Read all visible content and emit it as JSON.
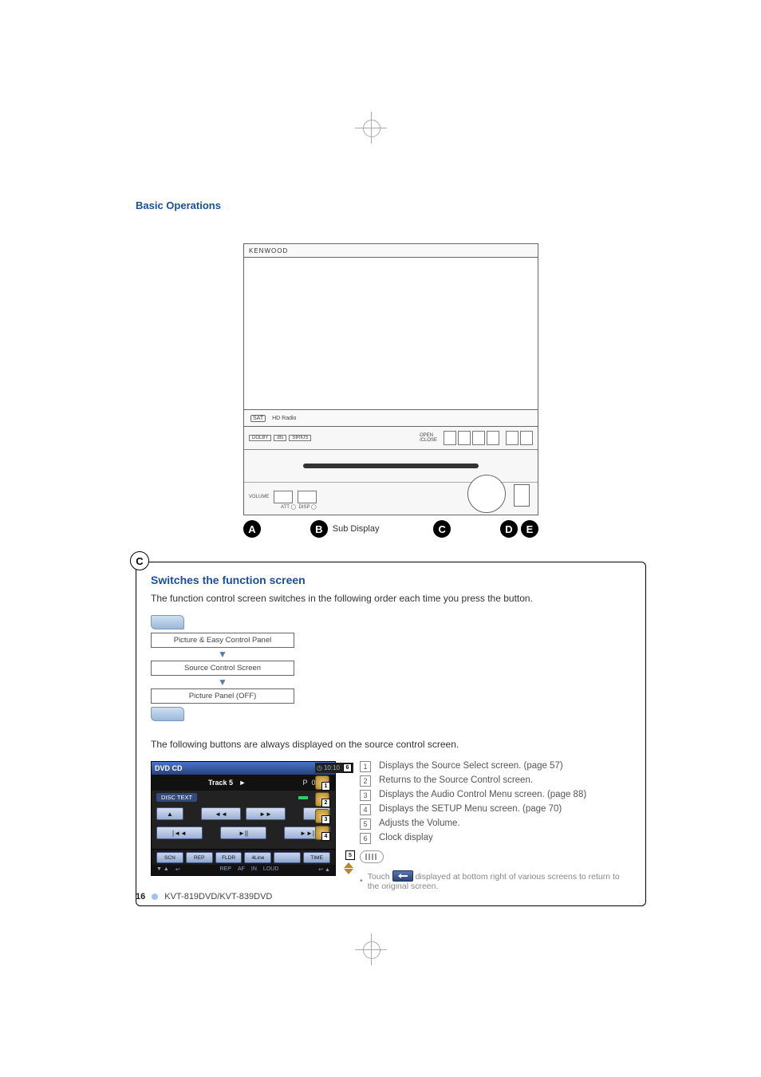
{
  "header": {
    "section_title": "Basic Operations"
  },
  "device": {
    "brand": "KENWOOD",
    "strip_badge_1": "SAT",
    "strip_badge_2": "HD Radio"
  },
  "callouts": {
    "a": "A",
    "b": "B",
    "c": "C",
    "d": "D",
    "e": "E",
    "sub_display": "Sub Display"
  },
  "box": {
    "badge": "C",
    "heading": "Switches the function screen",
    "intro": "The function control screen switches in the following order each time you press the button.",
    "flow": {
      "n1": "Picture & Easy Control Panel",
      "n2": "Source Control Screen",
      "n3": "Picture Panel (OFF)"
    },
    "mid_text": "The following buttons are always displayed on the source control screen.",
    "ui": {
      "title": "DVD CD",
      "clock": "10:10",
      "track": "Track 5",
      "play_glyph": "►",
      "prog_p": "P",
      "prog_time": "0:05",
      "disc_text": "DISC TEXT",
      "btn_eject": "▲",
      "btn_rew": "◄◄",
      "btn_ff": "►►",
      "btn_stop": "■",
      "btn_prev": "|◄◄",
      "btn_playpause": "►||",
      "btn_next": "►►|",
      "small": {
        "scn": "SCN",
        "rep": "REP",
        "fldr": "FLDR",
        "klink": "4Line",
        "blank": "",
        "time": "TIME"
      },
      "status": {
        "rep": "REP",
        "af": "AF",
        "in": "IN",
        "loud": "LOUD"
      },
      "side_clock_icon": "◷"
    },
    "list": {
      "i1": "Displays the Source Select screen. (page 57)",
      "i2": "Returns to the Source Control screen.",
      "i3": "Displays the Audio Control Menu screen. (page 88)",
      "i4": "Displays the SETUP Menu screen. (page 70)",
      "i5": "Adjusts the Volume.",
      "i6": "Clock display"
    },
    "note": {
      "text_a": "Touch",
      "text_b": "displayed at bottom right of various screens to return to the original screen."
    }
  },
  "footer": {
    "page": "16",
    "model": "KVT-819DVD/KVT-839DVD"
  }
}
